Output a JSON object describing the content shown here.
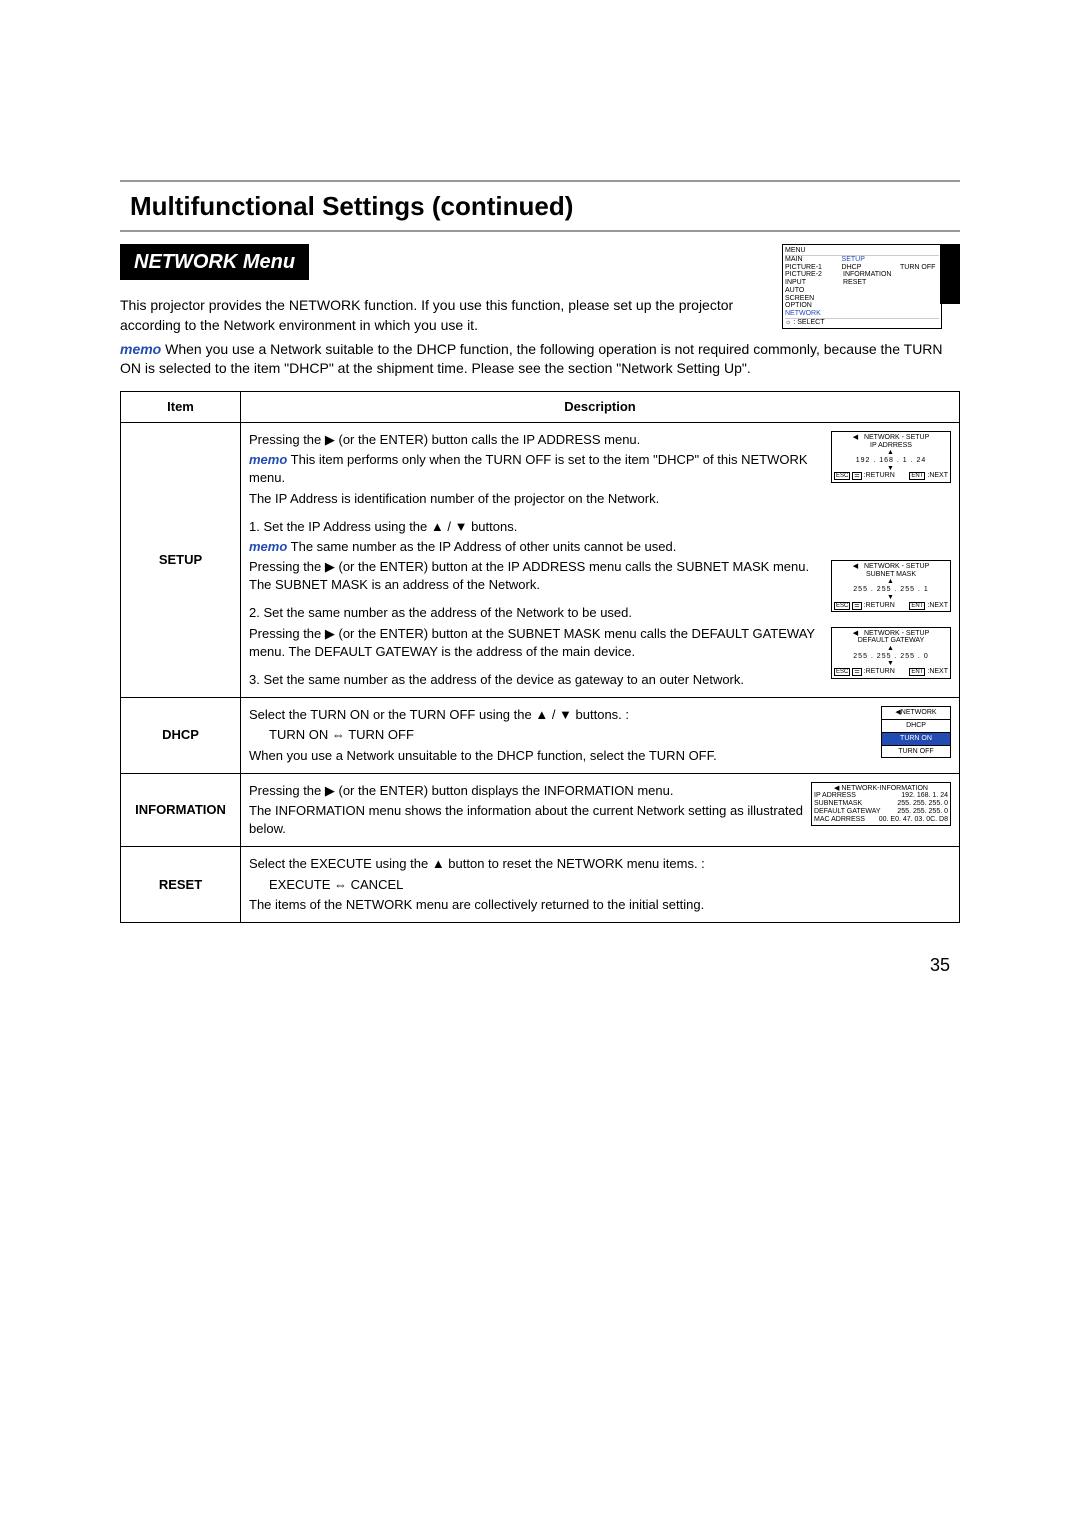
{
  "title": "Multifunctional Settings (continued)",
  "menu_label": "NETWORK Menu",
  "intro1": "This projector provides the NETWORK function. If you use this function, please set up the projector according to the Network environment in which you use it.",
  "memo_label": "memo",
  "intro2": " When you use a Network suitable to the DHCP function, the following operation is not required commonly, because the TURN ON is selected to the item \"DHCP\" at the shipment time. Please see the section \"Network Setting Up\".",
  "osd_menu": {
    "header": "MENU",
    "rows": [
      {
        "c1": "MAIN",
        "c2": "SETUP",
        "c3": ""
      },
      {
        "c1": "PICTURE-1",
        "c2": "DHCP",
        "c3": "TURN OFF"
      },
      {
        "c1": "PICTURE-2",
        "c2": "INFORMATION",
        "c3": ""
      },
      {
        "c1": "INPUT",
        "c2": "RESET",
        "c3": ""
      },
      {
        "c1": "AUTO",
        "c2": "",
        "c3": ""
      },
      {
        "c1": "SCREEN",
        "c2": "",
        "c3": ""
      },
      {
        "c1": "OPTION",
        "c2": "",
        "c3": ""
      },
      {
        "c1": "NETWORK",
        "c2": "",
        "c3": ""
      }
    ],
    "footer": "☼ : SELECT"
  },
  "table": {
    "head_item": "Item",
    "head_desc": "Description",
    "setup": {
      "label": "SETUP",
      "p1a": "Pressing the ",
      "p1b": " (or the ENTER) button calls the IP ADDRESS menu.",
      "p2a": " This item performs only when the TURN OFF is set to the item \"DHCP\" of this NETWORK menu.",
      "p3": "The IP Address is identification number of the projector on the Network.",
      "p4a": "1. Set the IP Address using the ",
      "p4b": " buttons.",
      "p5a": " The same number as the IP Address of other units cannot be used.",
      "p6a": "Pressing the ",
      "p6b": " (or the ENTER) button at the IP ADDRESS menu calls the SUBNET MASK menu. The SUBNET MASK is an address of the Network.",
      "p7": "2. Set the same number as the address of the Network to be used.",
      "p8a": "Pressing the ",
      "p8b": " (or the ENTER) button at the SUBNET MASK menu calls the DEFAULT GATEWAY menu. The DEFAULT GATEWAY is the address of the main device.",
      "p9": "3. Set the same number as the address of the device as gateway to an outer Network.",
      "osd_ip": {
        "title": "NETWORK - SETUP",
        "sub": "IP ADRRESS",
        "val": "192 . 168 .   1 .   24",
        "ret": ":RETURN",
        "next": ":NEXT"
      },
      "osd_sn": {
        "title": "NETWORK - SETUP",
        "sub": "SUBNET MASK",
        "val": "255 . 255 . 255 .    1",
        "ret": ":RETURN",
        "next": ":NEXT"
      },
      "osd_gw": {
        "title": "NETWORK - SETUP",
        "sub": "DEFAULT GATEWAY",
        "val": "255 . 255 . 255 .    0",
        "ret": ":RETURN",
        "next": ":NEXT"
      }
    },
    "dhcp": {
      "label": "DHCP",
      "p1a": "Select the TURN ON or the TURN OFF using the ",
      "p1b": " buttons. :",
      "p2": "TURN ON ⇔ TURN OFF",
      "p3": "When you use a Network unsuitable to the DHCP function, select the TURN OFF.",
      "osd": {
        "t1": "◀NETWORK",
        "t2": "DHCP",
        "t3": "TURN ON",
        "t4": "TURN OFF"
      }
    },
    "info": {
      "label": "INFORMATION",
      "p1a": "Pressing the ",
      "p1b": " (or the ENTER) button displays the INFORMATION menu.",
      "p2": "The INFORMATION menu shows the information about the current Network setting as illustrated below.",
      "osd": {
        "title": "◀ NETWORK-INFORMATION",
        "r1a": "IP ADRRESS",
        "r1b": "192. 168. 1. 24",
        "r2a": "SUBNETMASK",
        "r2b": "255. 255. 255. 0",
        "r3a": "DEFAULT GATEWAY",
        "r3b": "255. 255. 255. 0",
        "r4a": "MAC ADRRESS",
        "r4b": "00. E0. 47. 03. 0C. D8"
      }
    },
    "reset": {
      "label": "RESET",
      "p1a": "Select the EXECUTE using the ",
      "p1b": " button to reset the NETWORK menu items. :",
      "p2": "EXECUTE ⇔ CANCEL",
      "p3": "The items of the NETWORK menu are collectively returned to the initial setting."
    }
  },
  "arrows": {
    "right": "▶",
    "up": "▲",
    "down": "▼",
    "updown": "▲ / ▼"
  },
  "esc": "ESC",
  "menu_btn": "☰",
  "ent": "ENT",
  "page": "35"
}
